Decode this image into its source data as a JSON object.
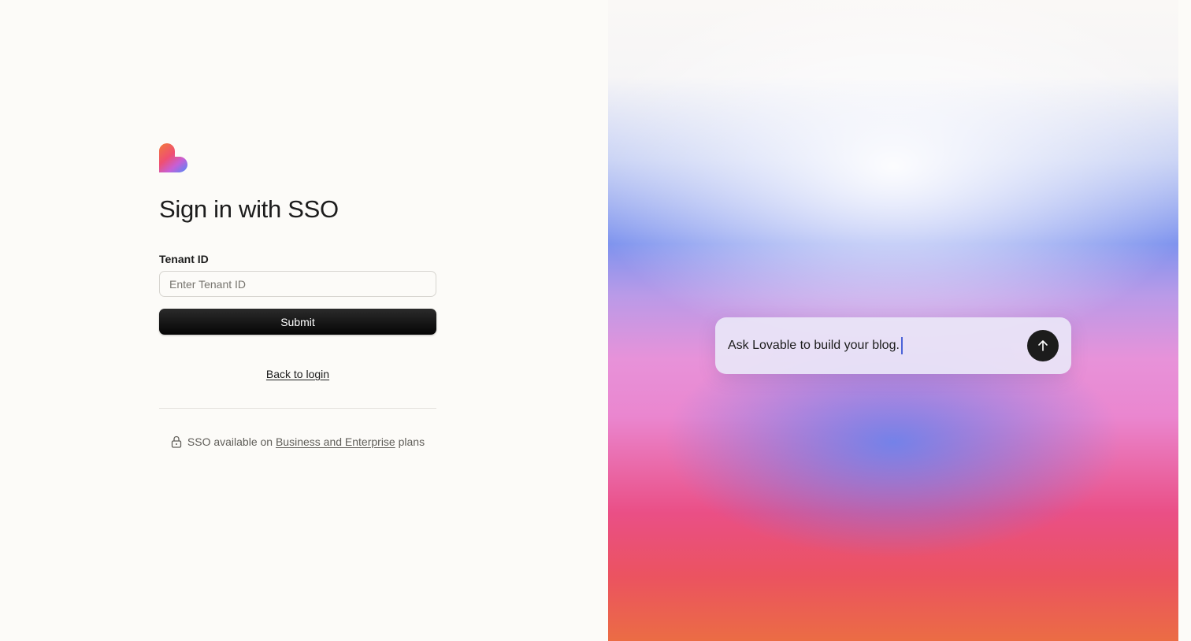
{
  "colors": {
    "page_background": "#fcfbf8",
    "text_primary": "#1c1c1c",
    "text_muted": "#5f5d58",
    "button_dark": "#1c1c1c",
    "caret": "#4b63d8"
  },
  "logo": {
    "icon": "lovable-heart-logo-icon"
  },
  "signin": {
    "title": "Sign in with SSO",
    "tenant_label": "Tenant ID",
    "tenant_value": "",
    "tenant_placeholder": "Enter Tenant ID",
    "submit_label": "Submit",
    "back_label": "Back to login",
    "sso_note_prefix": "SSO available on",
    "sso_note_link": "Business and Enterprise",
    "sso_note_suffix": "plans",
    "lock_icon": "lock-icon"
  },
  "prompt": {
    "text": "Ask Lovable to build your blog.",
    "send_icon": "arrow-up-icon"
  }
}
